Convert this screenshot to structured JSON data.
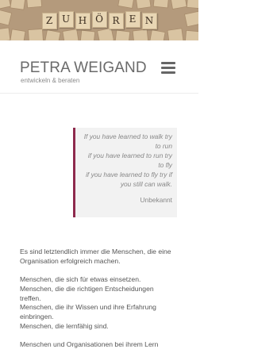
{
  "hero": {
    "letters": [
      "Z",
      "U",
      "H",
      "Ö",
      "R",
      "E",
      "N"
    ]
  },
  "header": {
    "title": "PETRA WEIGAND",
    "tagline": "entwickeln & beraten",
    "menu_icon": "hamburger-menu-icon"
  },
  "quote": {
    "text": "If you have learned to walk try\nto run\nif you have learned to run try\nto fly\nif you have learned to fly try if\nyou still can walk.",
    "author": "Unbekannt",
    "accent_color": "#8e2a4d"
  },
  "content": {
    "paragraph1": "Es sind letztendlich immer die Menschen, die eine Organisation erfolgreich machen.",
    "list": [
      "Menschen, die sich für etwas einsetzen.",
      "Menschen, die die richtigen Entscheidungen",
      "treffen.",
      "Menschen, die ihr Wissen und ihre Erfahrung",
      "einbringen.",
      "Menschen, die lernfähig sind."
    ],
    "cut_off_line": "Menschen und Organisationen bei ihrem Lern"
  }
}
